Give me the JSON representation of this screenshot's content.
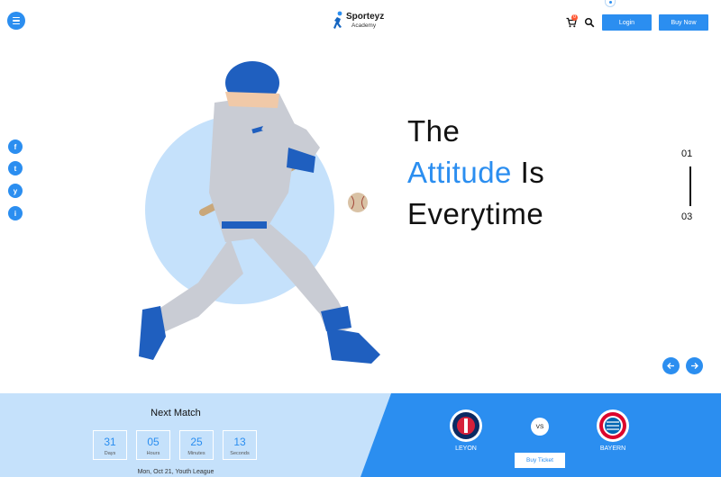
{
  "header": {
    "logo_name": "Sporteyz",
    "logo_sub": "Academy",
    "cart_count": "0",
    "login_label": "Login",
    "buy_label": "Buy Now"
  },
  "social": [
    "f",
    "t",
    "y",
    "i"
  ],
  "hero": {
    "line1": "The",
    "line2_accent": "Attitude",
    "line2_rest": " Is",
    "line3": "Everytime",
    "slide_current": "01",
    "slide_total": "03"
  },
  "next_match": {
    "title": "Next Match",
    "countdown": [
      {
        "value": "31",
        "label": "Days"
      },
      {
        "value": "05",
        "label": "Hours"
      },
      {
        "value": "25",
        "label": "Minutes"
      },
      {
        "value": "13",
        "label": "Seconds"
      }
    ],
    "info": "Mon, Oct 21, Youth League",
    "team_home": "LEYON",
    "team_away": "BAYERN",
    "vs_label": "VS",
    "ticket_label": "Buy Ticket"
  },
  "colors": {
    "accent": "#2b8ef0",
    "light_blue": "#c5e1fb"
  }
}
